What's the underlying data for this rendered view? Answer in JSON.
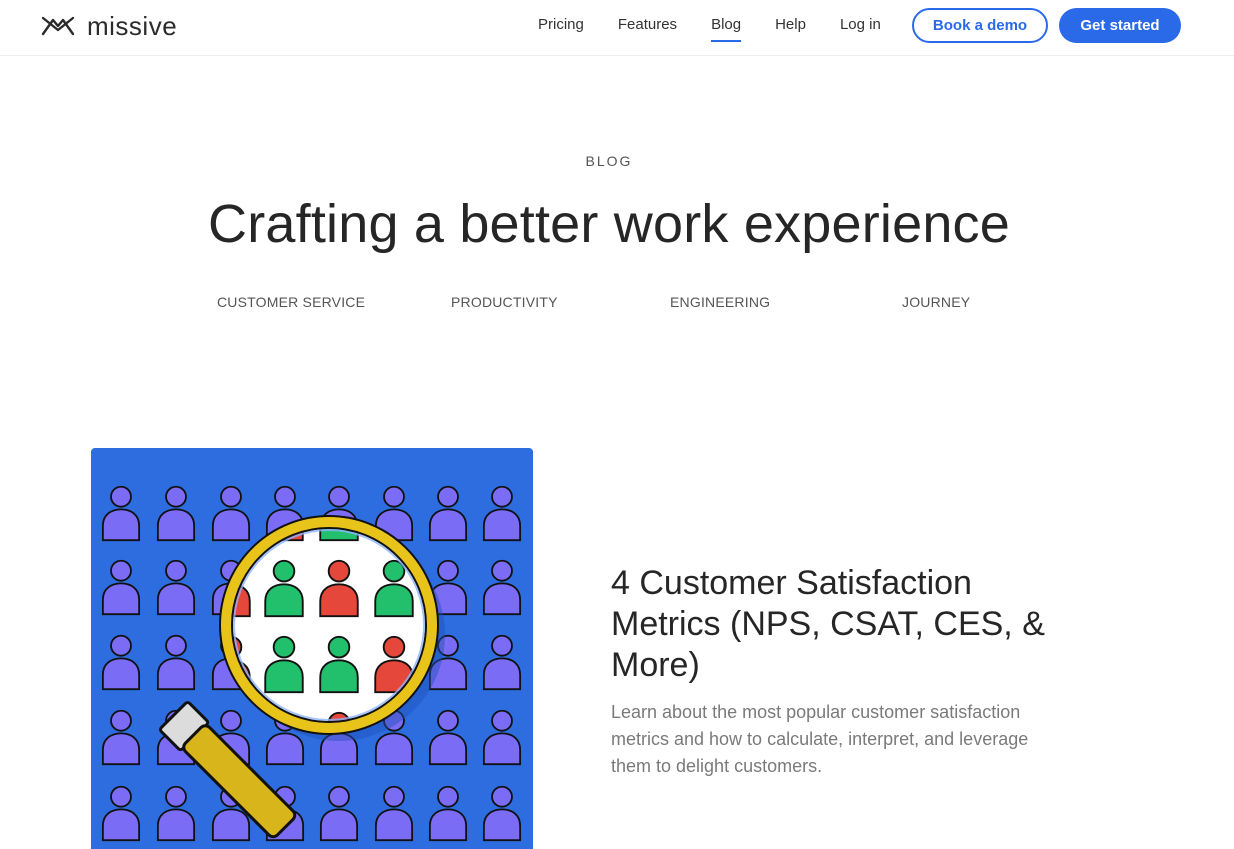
{
  "header": {
    "logo_text": "missive",
    "logo_icon": "missive-logo-icon",
    "nav": [
      {
        "label": "Pricing",
        "active": false
      },
      {
        "label": "Features",
        "active": false
      },
      {
        "label": "Blog",
        "active": true
      },
      {
        "label": "Help",
        "active": false
      },
      {
        "label": "Log in",
        "active": false
      }
    ],
    "book_demo_label": "Book a demo",
    "get_started_label": "Get started"
  },
  "hero": {
    "eyebrow": "BLOG",
    "title": "Crafting a better work experience",
    "categories": [
      "CUSTOMER SERVICE",
      "PRODUCTIVITY",
      "ENGINEERING",
      "JOURNEY"
    ]
  },
  "post": {
    "title": "4 Customer Satisfaction Metrics (NPS, CSAT, CES, & More)",
    "excerpt": "Learn about the most popular customer satisfaction metrics and how to calculate, interpret, and leverage them to delight customers.",
    "image_icon": "magnifying-glass-over-people-illustration"
  },
  "colors": {
    "accent": "#2a6ae8",
    "illustration_bg": "#2d6de0",
    "person_purple": "#7b6cf5",
    "person_green": "#22c06c",
    "person_red": "#e5483b",
    "lens_rim": "#e8c41a"
  }
}
